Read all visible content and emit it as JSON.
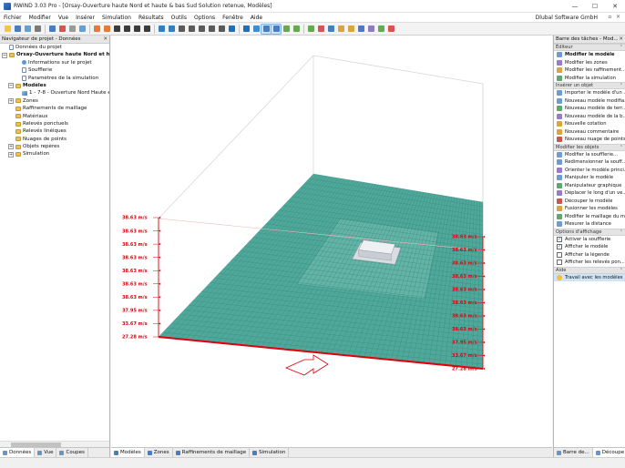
{
  "window": {
    "title": "RWIND 3.03 Pro - [Orsay-Ouverture haute Nord et haute & bas Sud Solution retenue, Modèles]",
    "minimize": "—",
    "maximize": "☐",
    "close": "✕"
  },
  "menu": {
    "items": [
      "Fichier",
      "Modifier",
      "Vue",
      "Insérer",
      "Simulation",
      "Résultats",
      "Outils",
      "Options",
      "Fenêtre",
      "Aide"
    ],
    "company": "Dlubal Software GmbH"
  },
  "navigator": {
    "title": "Navigateur de projet - Données",
    "tree": [
      {
        "label": "Données du projet",
        "level": 0,
        "expander": "",
        "icon": "doc",
        "bold": false
      },
      {
        "label": "Orsay-Ouverture haute Nord et haut",
        "level": 0,
        "expander": "−",
        "icon": "folder",
        "bold": true
      },
      {
        "label": "Informations sur le projet",
        "level": 2,
        "expander": "",
        "icon": "info",
        "bold": false
      },
      {
        "label": "Soufflerie",
        "level": 2,
        "expander": "",
        "icon": "doc",
        "bold": false
      },
      {
        "label": "Paramètres de la simulation",
        "level": 2,
        "expander": "",
        "icon": "doc",
        "bold": false
      },
      {
        "label": "Modèles",
        "level": 1,
        "expander": "−",
        "icon": "folder",
        "bold": true
      },
      {
        "label": "1 - 7-8 - Ouverture Nord Haute et S",
        "level": 2,
        "expander": "",
        "icon": "model",
        "bold": false
      },
      {
        "label": "Zones",
        "level": 1,
        "expander": "+",
        "icon": "folder",
        "bold": false
      },
      {
        "label": "Raffinements de maillage",
        "level": 1,
        "expander": "",
        "icon": "folder",
        "bold": false
      },
      {
        "label": "Matériaux",
        "level": 1,
        "expander": "",
        "icon": "folder",
        "bold": false
      },
      {
        "label": "Relevés ponctuels",
        "level": 1,
        "expander": "",
        "icon": "folder",
        "bold": false
      },
      {
        "label": "Relevés linéiques",
        "level": 1,
        "expander": "",
        "icon": "folder",
        "bold": false
      },
      {
        "label": "Nuages de points",
        "level": 1,
        "expander": "",
        "icon": "folder",
        "bold": false
      },
      {
        "label": "Objets repères",
        "level": 1,
        "expander": "+",
        "icon": "folder",
        "bold": false
      },
      {
        "label": "Simulation",
        "level": 1,
        "expander": "+",
        "icon": "folder",
        "bold": false
      }
    ],
    "tabs": [
      {
        "label": "Données",
        "active": true
      },
      {
        "label": "Vue",
        "active": false
      },
      {
        "label": "Coupes",
        "active": false
      }
    ]
  },
  "viewport": {
    "tabs": [
      {
        "label": "Modèles",
        "active": true
      },
      {
        "label": "Zones",
        "active": false
      },
      {
        "label": "Raffinements de maillage",
        "active": false
      },
      {
        "label": "Simulation",
        "active": false
      }
    ],
    "left_profile_labels": [
      "38.63 m/s",
      "38.63 m/s",
      "38.63 m/s",
      "38.63 m/s",
      "38.63 m/s",
      "38.63 m/s",
      "38.63 m/s",
      "37.95 m/s",
      "33.67 m/s",
      "27.28 m/s"
    ],
    "right_profile_labels": [
      "38.63 m/s",
      "38.63 m/s",
      "38.63 m/s",
      "38.63 m/s",
      "38.63 m/s",
      "38.63 m/s",
      "38.63 m/s",
      "38.63 m/s",
      "37.95 m/s",
      "33.67 m/s",
      "27.28 m/s"
    ],
    "colors": {
      "ground": "#4fa89a",
      "mesh": "#2f7f74",
      "profile": "#e0000b",
      "box": "#d8d8d8"
    }
  },
  "taskbar": {
    "title": "Barre des tâches - Mod...",
    "sections": [
      {
        "title": "Éditeur",
        "items": [
          {
            "label": "Modifier le modèle",
            "bold": true,
            "icon": "t1"
          },
          {
            "label": "Modifier les zones",
            "bold": false,
            "icon": "t2"
          },
          {
            "label": "Modifier les raffinement...",
            "bold": false,
            "icon": "t3"
          },
          {
            "label": "Modifier la simulation",
            "bold": false,
            "icon": "t4"
          }
        ]
      },
      {
        "title": "Insérer un objet",
        "items": [
          {
            "label": "Importer le modèle d'un ...",
            "bold": false,
            "icon": "t1"
          },
          {
            "label": "Nouveau modèle modifia...",
            "bold": false,
            "icon": "t1"
          },
          {
            "label": "Nouveau modèle de terr...",
            "bold": false,
            "icon": "t4"
          },
          {
            "label": "Nouveau modèle de la b...",
            "bold": false,
            "icon": "t2"
          },
          {
            "label": "Nouvelle cotation",
            "bold": false,
            "icon": "t3"
          },
          {
            "label": "Nouveau commentaire",
            "bold": false,
            "icon": "t3"
          },
          {
            "label": "Nouveau nuage de points",
            "bold": false,
            "icon": "t5"
          }
        ]
      },
      {
        "title": "Modifier les objets",
        "items": [
          {
            "label": "Modifier la soufflerie...",
            "bold": false,
            "icon": "t1"
          },
          {
            "label": "Redimensionner la souff...",
            "bold": false,
            "icon": "t1"
          },
          {
            "label": "Orienter le modèle princi...",
            "bold": false,
            "icon": "t2"
          },
          {
            "label": "Manipuler le modèle",
            "bold": false,
            "icon": "t1"
          },
          {
            "label": "Manipulateur graphique",
            "bold": false,
            "icon": "t4"
          },
          {
            "label": "Déplacer le long d'un ve...",
            "bold": false,
            "icon": "t2"
          },
          {
            "label": "Découper le modèle",
            "bold": false,
            "icon": "t5"
          },
          {
            "label": "Fusionner les modèles",
            "bold": false,
            "icon": "t3"
          },
          {
            "label": "Modifier le maillage du m...",
            "bold": false,
            "icon": "t4"
          },
          {
            "label": "Mesurer la distance",
            "bold": false,
            "icon": "t1"
          }
        ]
      }
    ],
    "display_section": {
      "title": "Options d'affichage",
      "items": [
        {
          "label": "Activer la soufflerie",
          "checked": true
        },
        {
          "label": "Afficher le modèle",
          "checked": true
        },
        {
          "label": "Afficher la légende",
          "checked": false
        },
        {
          "label": "Afficher les relevés pon...",
          "checked": false
        }
      ]
    },
    "help_section": {
      "title": "Aide",
      "items": [
        {
          "label": "Travail avec les modèles"
        }
      ]
    },
    "tabs": [
      {
        "label": "Barre de...",
        "active": false
      },
      {
        "label": "Découpe",
        "active": true
      }
    ]
  }
}
